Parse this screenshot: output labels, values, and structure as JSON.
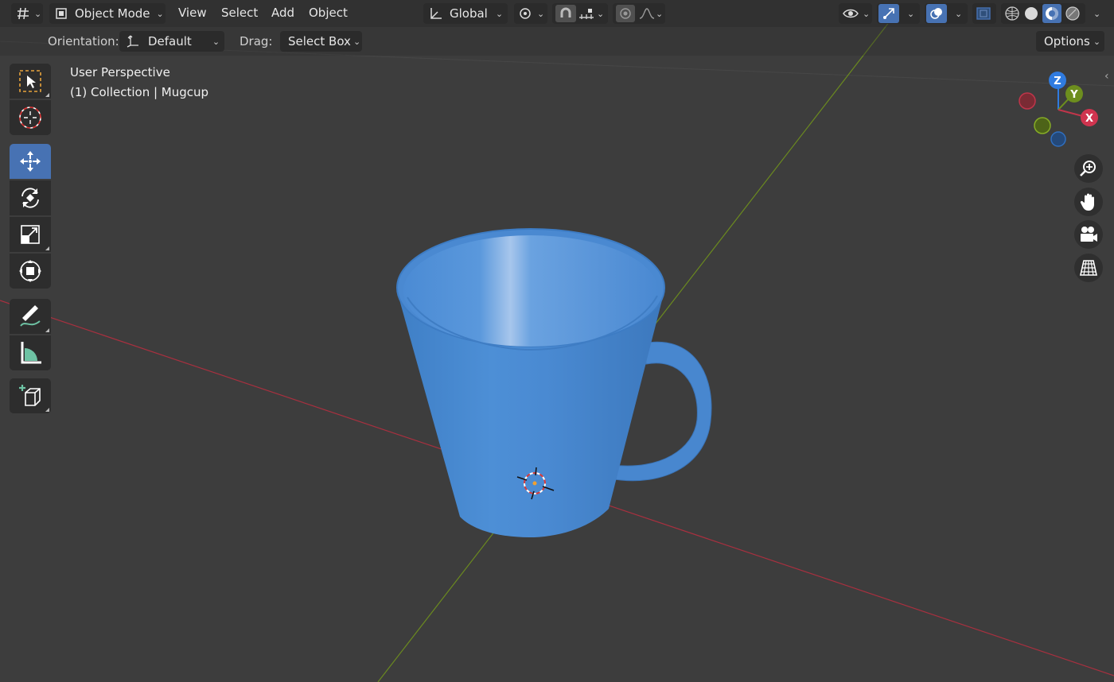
{
  "header": {
    "editor_type_icon": "editor-type-icon",
    "mode": "Object Mode",
    "menus": [
      "View",
      "Select",
      "Add",
      "Object"
    ],
    "transform_orientation": "Global",
    "pivot_icon": "pivot-point-icon",
    "snap_icon": "snap-magnet-icon",
    "snap_increment_icon": "snap-increment-icon",
    "proportional_icon": "proportional-edit-icon",
    "falloff_icon": "falloff-curve-icon",
    "visibility_icon": "eye-icon",
    "gizmo_icon": "gizmo-icon",
    "overlay_icon": "overlay-icon",
    "xray_icon": "xray-icon",
    "shading_modes": [
      "wireframe",
      "solid",
      "material-preview",
      "rendered"
    ],
    "active_shading": "material-preview"
  },
  "tool_settings": {
    "orientation_label": "Orientation:",
    "orientation_value": "Default",
    "drag_label": "Drag:",
    "drag_value": "Select Box",
    "options_label": "Options"
  },
  "overlay_text": {
    "view_name": "User Perspective",
    "collection_line": "(1) Collection | Mugcup"
  },
  "toolbar": [
    "select-box",
    "cursor",
    "move",
    "rotate",
    "scale",
    "transform",
    "annotate",
    "measure",
    "add-cube"
  ],
  "active_tool": "move",
  "nav_gizmo": {
    "z": "Z",
    "y": "Y",
    "x": "X"
  },
  "colors": {
    "accent": "#4772b3",
    "x_axis": "#c0354a",
    "y_axis": "#6d8e1e",
    "z_axis": "#2f7be0",
    "mug": "#4a8ad0",
    "background": "#3d3d3d"
  }
}
